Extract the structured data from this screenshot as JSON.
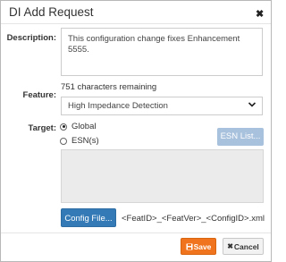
{
  "dialog": {
    "title": "DI Add Request",
    "close_glyph": "✖"
  },
  "description": {
    "label": "Description:",
    "value": "This configuration change fixes Enhancement 5555.",
    "remaining": "751 characters remaining"
  },
  "feature": {
    "label": "Feature:",
    "selected": "High Impedance Detection"
  },
  "target": {
    "label": "Target:",
    "options": [
      {
        "label": "Global",
        "selected": true
      },
      {
        "label": "ESN(s)",
        "selected": false
      }
    ],
    "esn_button": "ESN List..."
  },
  "config": {
    "button": "Config File...",
    "pattern": "<FeatID>_<FeatVer>_<ConfigID>.xml"
  },
  "footer": {
    "save_icon": "save-icon",
    "save": "Save",
    "cancel_icon": "x-icon",
    "cancel": "Cancel"
  },
  "colors": {
    "primary": "#337ab7",
    "save": "#f0741e",
    "esn_disabled": "#a8c1dd"
  }
}
